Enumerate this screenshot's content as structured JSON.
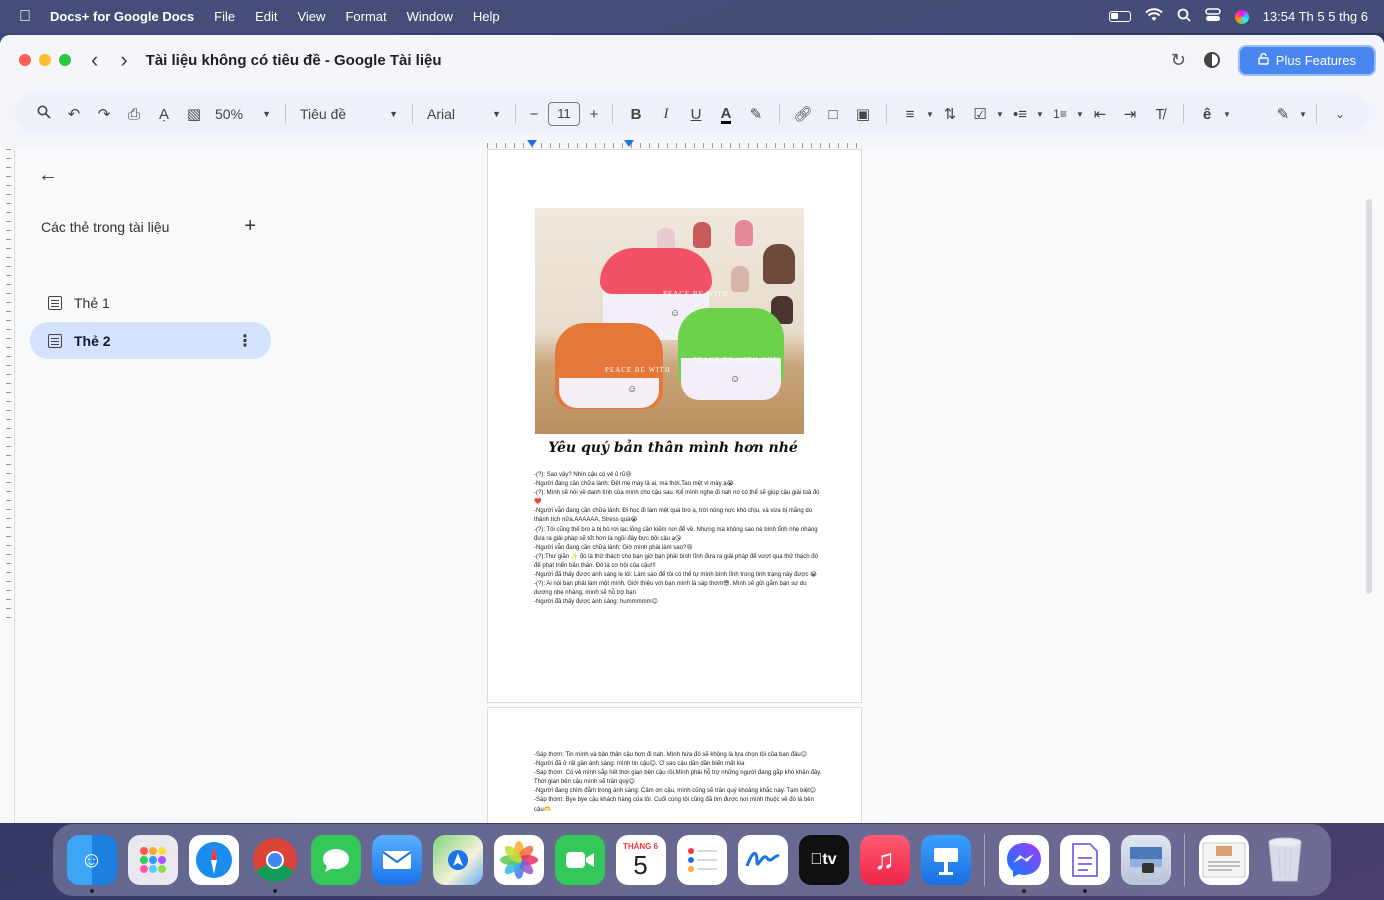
{
  "menubar": {
    "app_name": "Docs+ for Google Docs",
    "items": [
      "File",
      "Edit",
      "View",
      "Format",
      "Window",
      "Help"
    ],
    "clock": "13:54 Th 5 5 thg 6"
  },
  "window": {
    "title": "Tài liệu không có tiêu đề - Google Tài liệu",
    "plus_button": "Plus Features"
  },
  "toolbar": {
    "zoom": "50%",
    "style": "Tiêu đề",
    "font": "Arial",
    "font_size": "11",
    "bold": "B",
    "italic": "I",
    "underline": "U",
    "text_color": "A"
  },
  "sidebar": {
    "header": "Các thẻ trong tài liệu",
    "tabs": [
      {
        "label": "Thẻ 1"
      },
      {
        "label": "Thẻ 2"
      }
    ]
  },
  "document": {
    "heading": "Yêu quý bản thân mình hơn nhé",
    "photo_labels": [
      "PEACE BE WITH",
      "PEACE BE WITH",
      "PEACE BE WITH YOU"
    ],
    "page1_lines": [
      "-(?): Sao vậy? Nhìn cậu có vẻ ủ rũ😢",
      "-Người đang cần chữa lành: Đệt mẹ mày là ai, mà thời.Tao mệt vl mày ạ😭",
      "-(?): Mình sẽ nói về danh tính của mình cho cậu sau. Kể mình nghe đi nah nó có thể sẽ giúp cậu giải toả đó❤️",
      "-Người vẫn đang cần chữa lành: Đi học đi làm mệt quá bro ạ, trời nóng nực khó chịu, và vừa bị mắng do thành tích nữa.AAAAAA, Stress quá😭",
      "-(?): Tôi cũng thế bro à bị bỏ rơi lạc lõng cần kiếm nơi để về. Nhưng mà không sao nè bình tĩnh nhẹ nhàng đưa ra giải pháp sẽ tốt hơn là ngồi đây bực bội cậu ạ😘",
      "-Người vẫn đang cần chữa lành: Giờ mình phải làm sao?😢",
      "-(?):Thư giãn ✨ đó là thử thách cho bạn giờ bạn phải bình tĩnh đưa ra giải pháp để vượt qua thử thách đó để phát triển bản thân. Đó là cơ hội của cậu!!!",
      "-Người đã thấy được ánh sáng le lói: Làm sao để tôi có thể tự mình bình tĩnh trong tình trạng này được 😭",
      "-(?): Ai nói bạn phải làm một mình. Giới thiệu với bạn mình là sáp thơm😎. Mình sẽ gửi gắm bạn sự du dương nhẹ nhàng, mình sẽ hỗ trợ bạn",
      "-Người đã thấy được ánh sáng: hummmmm😊"
    ],
    "page2_lines": [
      "-Sáp thơm: Tin mình và bản thân cậu hơn đi nah. Mình hứa đó sẽ không là lựa chọn tồi của bạn đâu😊",
      "-Người đã ở rất gần ánh sáng: mình tin cậu😊. Ơ sao cậu dần dần biến mất kia",
      "-Sáp thơm: Có vẻ mình sắp hết thời gian bên cậu rồi.Mình phải hỗ trợ những người đang gặp khó khăn đây. Thời gian bên cậu mình sẽ trân quý😊",
      "-Người đang chìm đắm trong ánh sáng: Cảm ơn cậu, mình cũng sẽ trân quý khoảng khắc này. Tạm biệt😊",
      "-Sáp thơm: Bye bye cậu khách hàng của tôi. Cuối cùng tôi cũng đã tìm được nơi mình thuộc về đó là bên cậu🫶"
    ]
  },
  "dock": {
    "calendar_month": "THÁNG 6",
    "calendar_day": "5",
    "tv_label": "tv",
    "apps": [
      "finder-icon",
      "launchpad-icon",
      "safari-icon",
      "chrome-icon",
      "messages-icon",
      "mail-icon",
      "maps-icon",
      "photos-icon",
      "facetime-icon",
      "calendar-icon",
      "reminders-icon",
      "freeform-icon",
      "apple-tv-icon",
      "music-icon",
      "keynote-icon",
      "messenger-icon",
      "docs-plus-icon",
      "preview-icon",
      "document-thumbnail-icon",
      "trash-icon"
    ]
  },
  "colors": {
    "accent": "#4a86f0",
    "active_tab": "#d3e3fd",
    "toolbar_bg": "#edf2fa"
  }
}
